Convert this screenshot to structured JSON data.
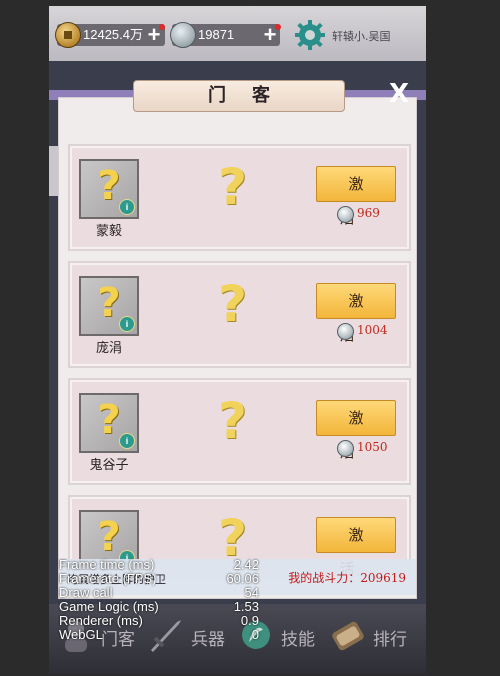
{
  "topbar": {
    "gold_amount": "12425.4万",
    "jade_amount": "19871",
    "plus_label": "+",
    "username": "轩辕小.吴国"
  },
  "dialog": {
    "title": "门客",
    "close_label": "X"
  },
  "retainers": [
    {
      "name": "蒙毅",
      "activate_label": "激活",
      "cost": "969",
      "unknown": "?"
    },
    {
      "name": "庞涓",
      "activate_label": "激活",
      "cost": "1004",
      "unknown": "?"
    },
    {
      "name": "鬼谷子",
      "activate_label": "激活",
      "cost": "1050",
      "unknown": "?"
    },
    {
      "name": "",
      "activate_label": "激活",
      "cost": "",
      "unknown": "?"
    }
  ],
  "info_strip": {
    "left_text": "均属增多上阵的护卫",
    "combat_power": "我的战斗力：209619"
  },
  "nav": [
    {
      "label": "门客",
      "icon": "retainer-icon"
    },
    {
      "label": "兵器",
      "icon": "weapon-icon"
    },
    {
      "label": "技能",
      "icon": "skill-icon"
    },
    {
      "label": "排行",
      "icon": "ranking-icon"
    }
  ],
  "debug": [
    {
      "label": "Frame time (ms)",
      "value": "2.42"
    },
    {
      "label": "Framerate (FPS)",
      "value": "60.06"
    },
    {
      "label": "Draw call",
      "value": "54"
    },
    {
      "label": "Game Logic (ms)",
      "value": "1.53"
    },
    {
      "label": "Renderer (ms)",
      "value": "0.9"
    },
    {
      "label": "WebGL",
      "value": "0"
    }
  ],
  "colors": {
    "accent_gold": "#f2b53a",
    "cost_red": "#c0281d",
    "power_red": "#c21a1a",
    "band_purple": "#8e7fb8"
  }
}
